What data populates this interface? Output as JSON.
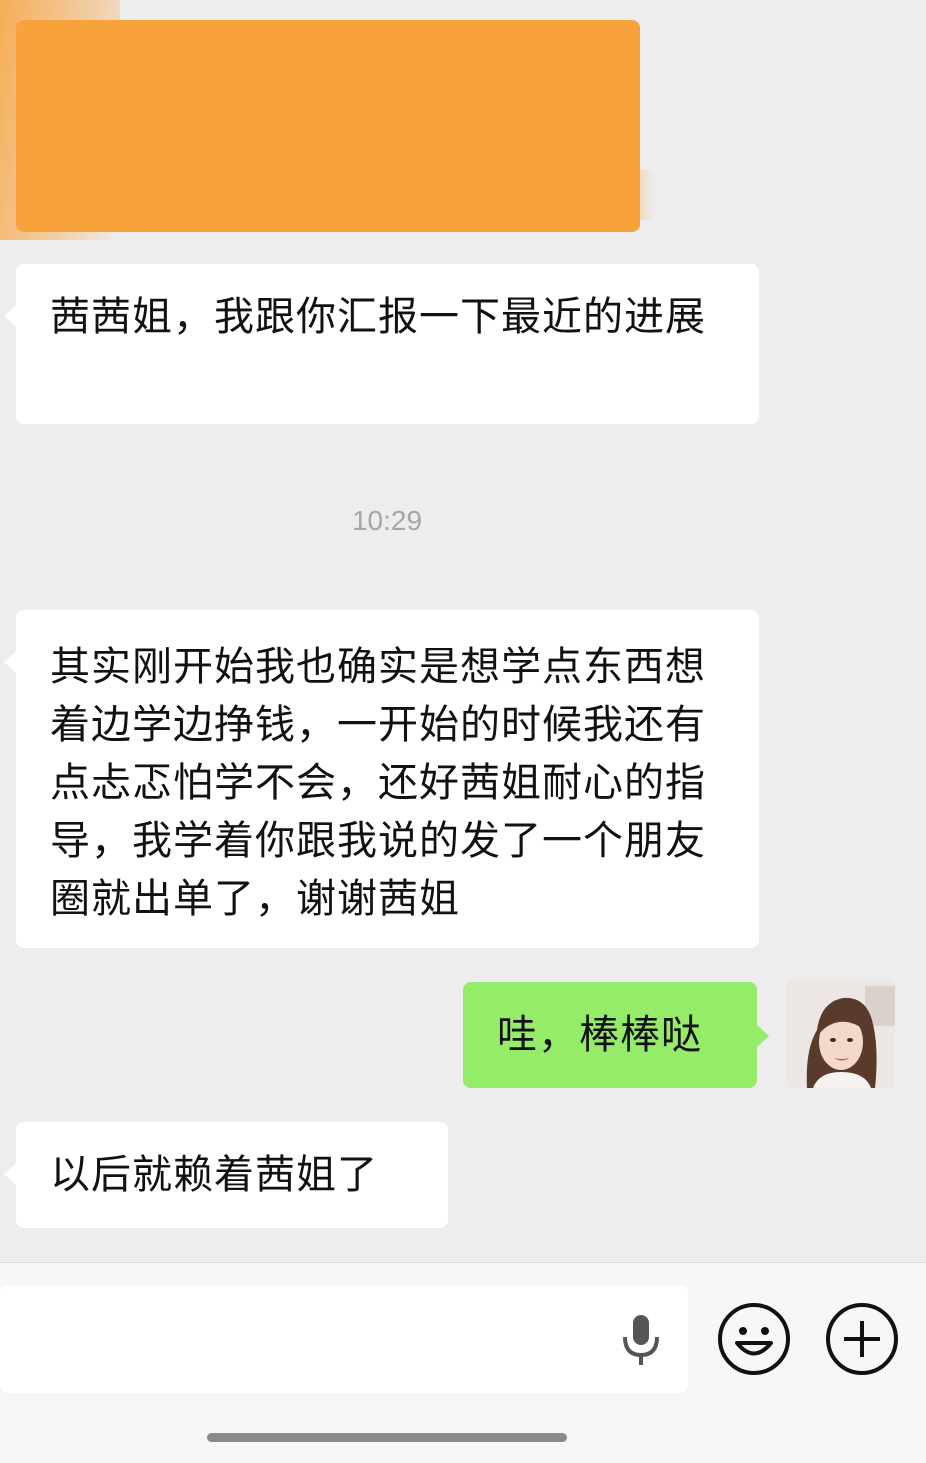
{
  "chat": {
    "messages": [
      {
        "side": "in",
        "text": "茜茜姐，我跟你汇报一下最近的进展"
      },
      {
        "side": "in",
        "text": "其实刚开始我也确实是想学点东西想着边学边挣钱，一开始的时候我还有点忐忑怕学不会，还好茜姐耐心的指导，我学着你跟我说的发了一个朋友圈就出单了，谢谢茜姐"
      },
      {
        "side": "out",
        "text": "哇，棒棒哒"
      },
      {
        "side": "in",
        "text": "以后就赖着茜姐了"
      }
    ],
    "timestamp": "10:29"
  },
  "input": {
    "icons": [
      "microphone-icon",
      "emoji-icon",
      "plus-icon"
    ]
  },
  "colors": {
    "background": "#ededed",
    "incoming_bubble": "#ffffff",
    "outgoing_bubble": "#95ec69",
    "redaction": "#f7a23b",
    "timestamp_text": "#a6a6a6"
  }
}
